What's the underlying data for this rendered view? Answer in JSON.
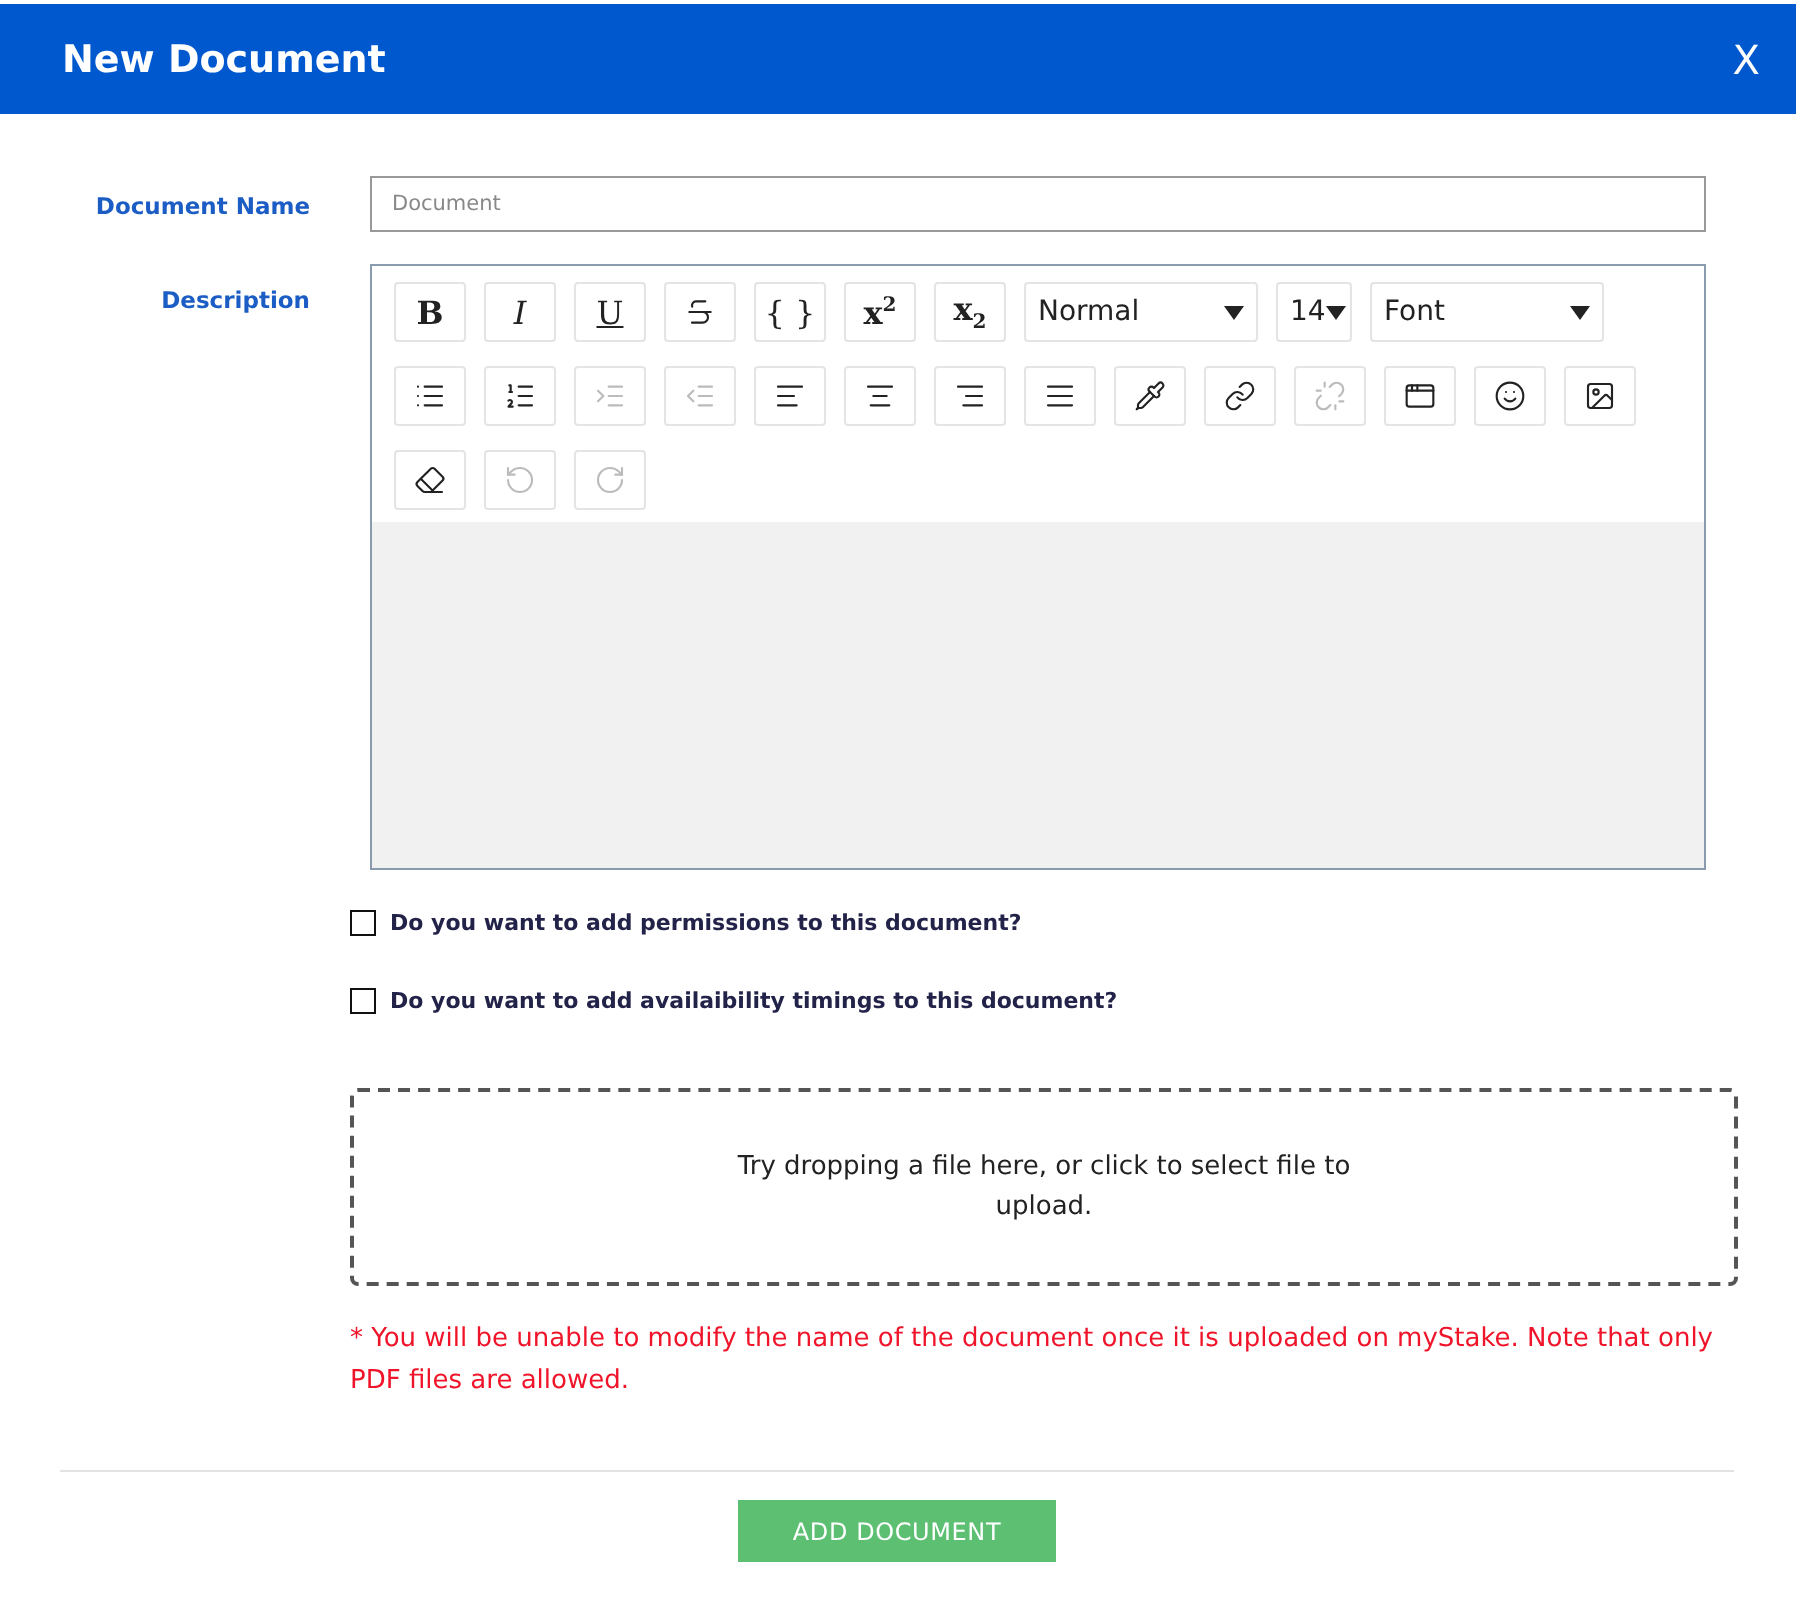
{
  "dialog": {
    "title": "New Document",
    "close": "X"
  },
  "fields": {
    "name_label": "Document Name",
    "name_placeholder": "Document",
    "description_label": "Description"
  },
  "toolbar": [
    {
      "kind": "text",
      "label": "B",
      "disabled": false
    },
    {
      "kind": "text",
      "label": "I",
      "disabled": false
    },
    {
      "kind": "text",
      "label": "U",
      "disabled": false
    },
    {
      "kind": "icon",
      "disabled": false
    },
    {
      "kind": "text",
      "label": "{ }",
      "disabled": false
    },
    {
      "kind": "text",
      "label": "x$^{2}$",
      "disabled": false
    },
    {
      "kind": "text",
      "label": "x$_{2}$",
      "disabled": false
    },
    {
      "kind": "select",
      "label": "Normal"
    },
    {
      "kind": "select",
      "label": "14"
    },
    {
      "kind": "select",
      "label": "Font"
    },
    {
      "kind": "icon",
      "disabled": false
    },
    {
      "kind": "icon",
      "disabled": false
    },
    {
      "kind": "icon",
      "disabled": true
    },
    {
      "kind": "icon",
      "disabled": true
    },
    {
      "kind": "icon",
      "disabled": false
    },
    {
      "kind": "icon",
      "disabled": false
    },
    {
      "kind": "icon",
      "disabled": false
    },
    {
      "kind": "icon",
      "disabled": false
    },
    {
      "kind": "icon",
      "disabled": false
    },
    {
      "kind": "icon",
      "disabled": false
    },
    {
      "kind": "icon",
      "disabled": true
    },
    {
      "kind": "icon",
      "disabled": false
    },
    {
      "kind": "icon",
      "disabled": false
    },
    {
      "kind": "icon",
      "disabled": false
    },
    {
      "kind": "icon",
      "disabled": false
    },
    {
      "kind": "icon",
      "disabled": true
    },
    {
      "kind": "icon",
      "disabled": true
    }
  ],
  "options": [
    {
      "label": "Do you want to add permissions to this document?",
      "checked": false
    },
    {
      "label": "Do you want to add availaibility timings to this document?",
      "checked": false
    }
  ],
  "dropzone": "Try dropping a file here, or click to select file to upload.",
  "note": "* You will be unable to modify the name of the document once it is uploaded on myStake. Note that only PDF files are allowed.",
  "submit": "ADD DOCUMENT"
}
